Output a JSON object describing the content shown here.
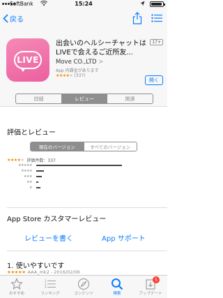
{
  "status": {
    "carrier": "SoftBank",
    "time": "15:24"
  },
  "nav": {
    "back_label": "戻る"
  },
  "app": {
    "icon_text": "LIVE",
    "title": "出会いのヘルシーチャットはLIVEで会えるご近所友...",
    "age_rating": "17+",
    "developer": "Move CO.,LTD",
    "developer_chevron": ">",
    "iap_note": "App 内課金があります",
    "rating_count": "(337)",
    "open_label": "開く"
  },
  "tabs": {
    "details": "詳細",
    "reviews": "レビュー",
    "related": "関連"
  },
  "ratings_section": {
    "title": "評価とレビュー",
    "current_version": "現在のバージョン",
    "all_versions": "すべてのバージョン",
    "count_text": "評価件数：337",
    "histogram": [
      {
        "stars": 5,
        "fraction": 0.82
      },
      {
        "stars": 4,
        "fraction": 0.07
      },
      {
        "stars": 3,
        "fraction": 0.05
      },
      {
        "stars": 2,
        "fraction": 0.02
      },
      {
        "stars": 1,
        "fraction": 0.04
      }
    ]
  },
  "support_section": {
    "title": "App Store カスタマーレビュー",
    "write_review": "レビューを書く",
    "app_support": "App サポート"
  },
  "review": {
    "title": "1. 使いやすいです",
    "author_date": "AAA_mk2 - 2016/02/06"
  },
  "tabbar": {
    "items": [
      {
        "label": "おすすめ",
        "icon": "star-icon"
      },
      {
        "label": "ランキング",
        "icon": "ranking-list-icon"
      },
      {
        "label": "コンテンツ",
        "icon": "compass-icon"
      },
      {
        "label": "検索",
        "icon": "search-icon"
      },
      {
        "label": "アップデート",
        "icon": "updates-icon"
      }
    ],
    "update_badge": "5"
  },
  "colors": {
    "accent": "#0a7cff",
    "star": "#f08c00",
    "badge": "#ff3b30",
    "app_icon": "#ef6fa8"
  }
}
